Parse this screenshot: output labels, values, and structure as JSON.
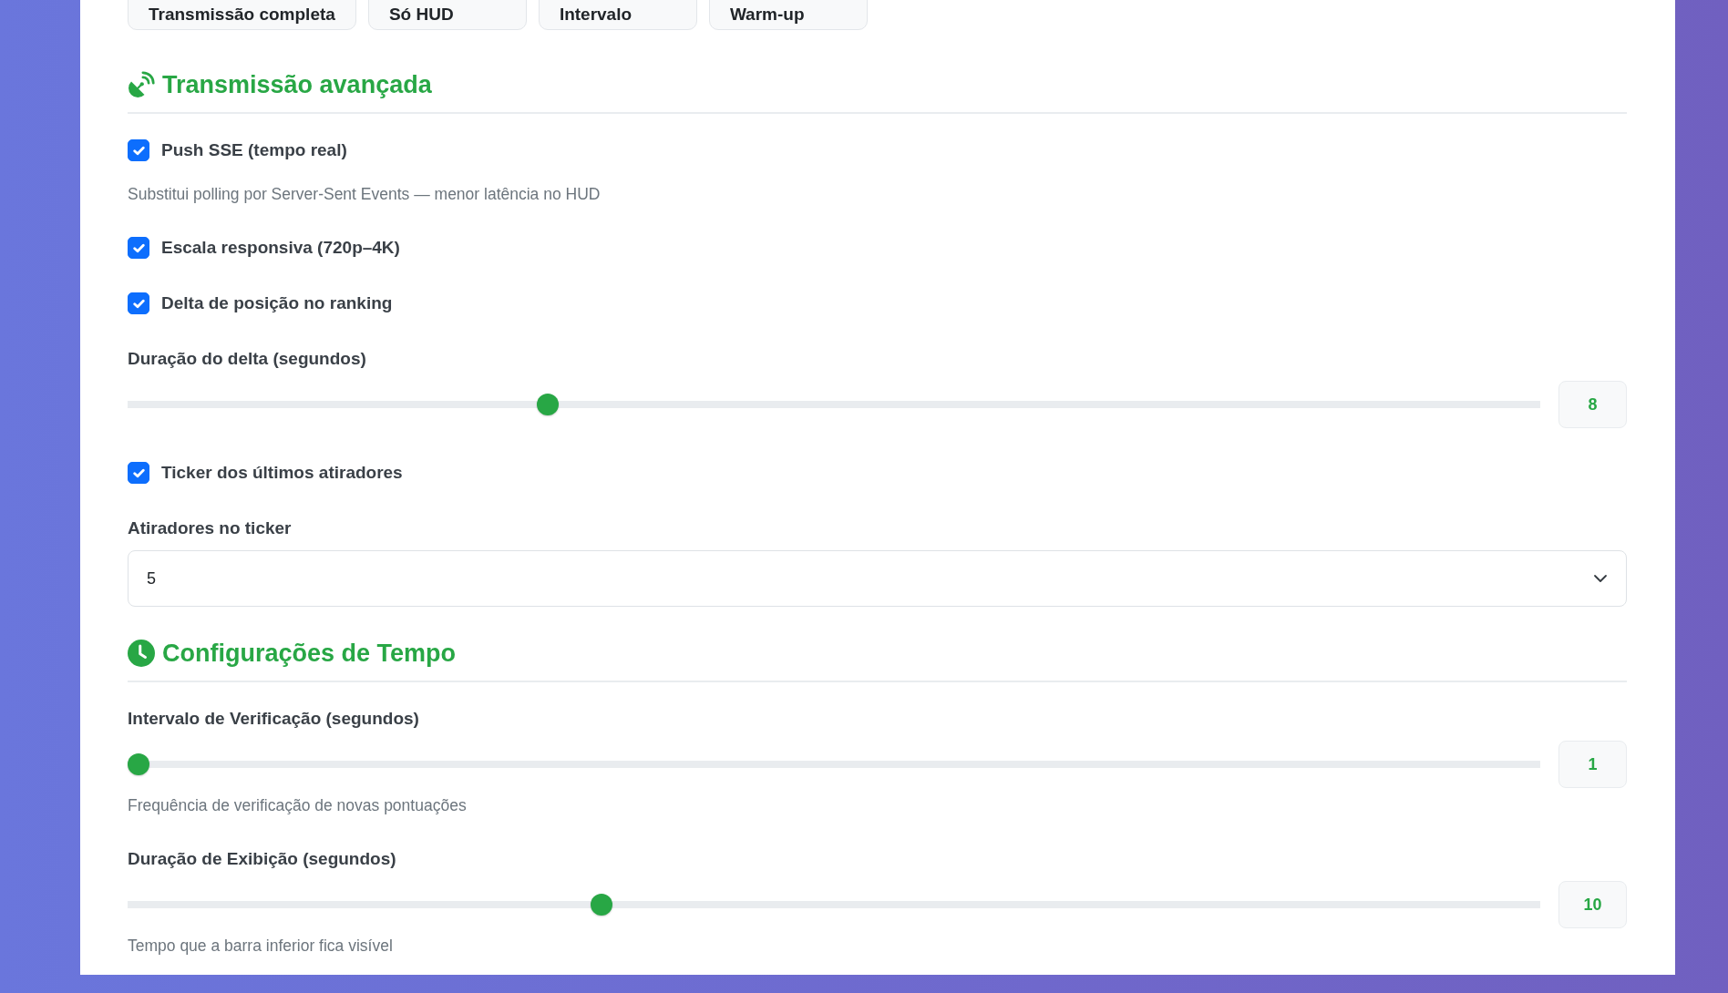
{
  "presets": [
    {
      "label": "Transmissão completa"
    },
    {
      "label": "Só HUD"
    },
    {
      "label": "Intervalo"
    },
    {
      "label": "Warm-up"
    }
  ],
  "sections": [
    {
      "title": "Transmissão avançada",
      "items": [
        {
          "kind": "checkbox",
          "label": "Push SSE (tempo real)",
          "checked": true,
          "help": "Substitui polling por Server-Sent Events — menor latência no HUD"
        },
        {
          "kind": "checkbox",
          "label": "Escala responsiva (720p–4K)",
          "checked": true
        },
        {
          "kind": "checkbox",
          "label": "Delta de posição no ranking",
          "checked": true
        },
        {
          "kind": "slider",
          "label": "Duração do delta (segundos)",
          "level": 0.294,
          "value": "8"
        },
        {
          "kind": "checkbox",
          "label": "Ticker dos últimos atiradores",
          "checked": true
        },
        {
          "kind": "select",
          "label": "Atiradores no ticker",
          "value": "5"
        }
      ]
    },
    {
      "title": "Configurações de Tempo",
      "items": [
        {
          "kind": "slider",
          "label": "Intervalo de Verificação (segundos)",
          "level": 0,
          "value": "1",
          "help": "Frequência de verificação de novas pontuações"
        },
        {
          "kind": "slider",
          "label": "Duração de Exibição (segundos)",
          "level": 0.333,
          "value": "10",
          "help": "Tempo que a barra inferior fica visível"
        }
      ]
    }
  ]
}
